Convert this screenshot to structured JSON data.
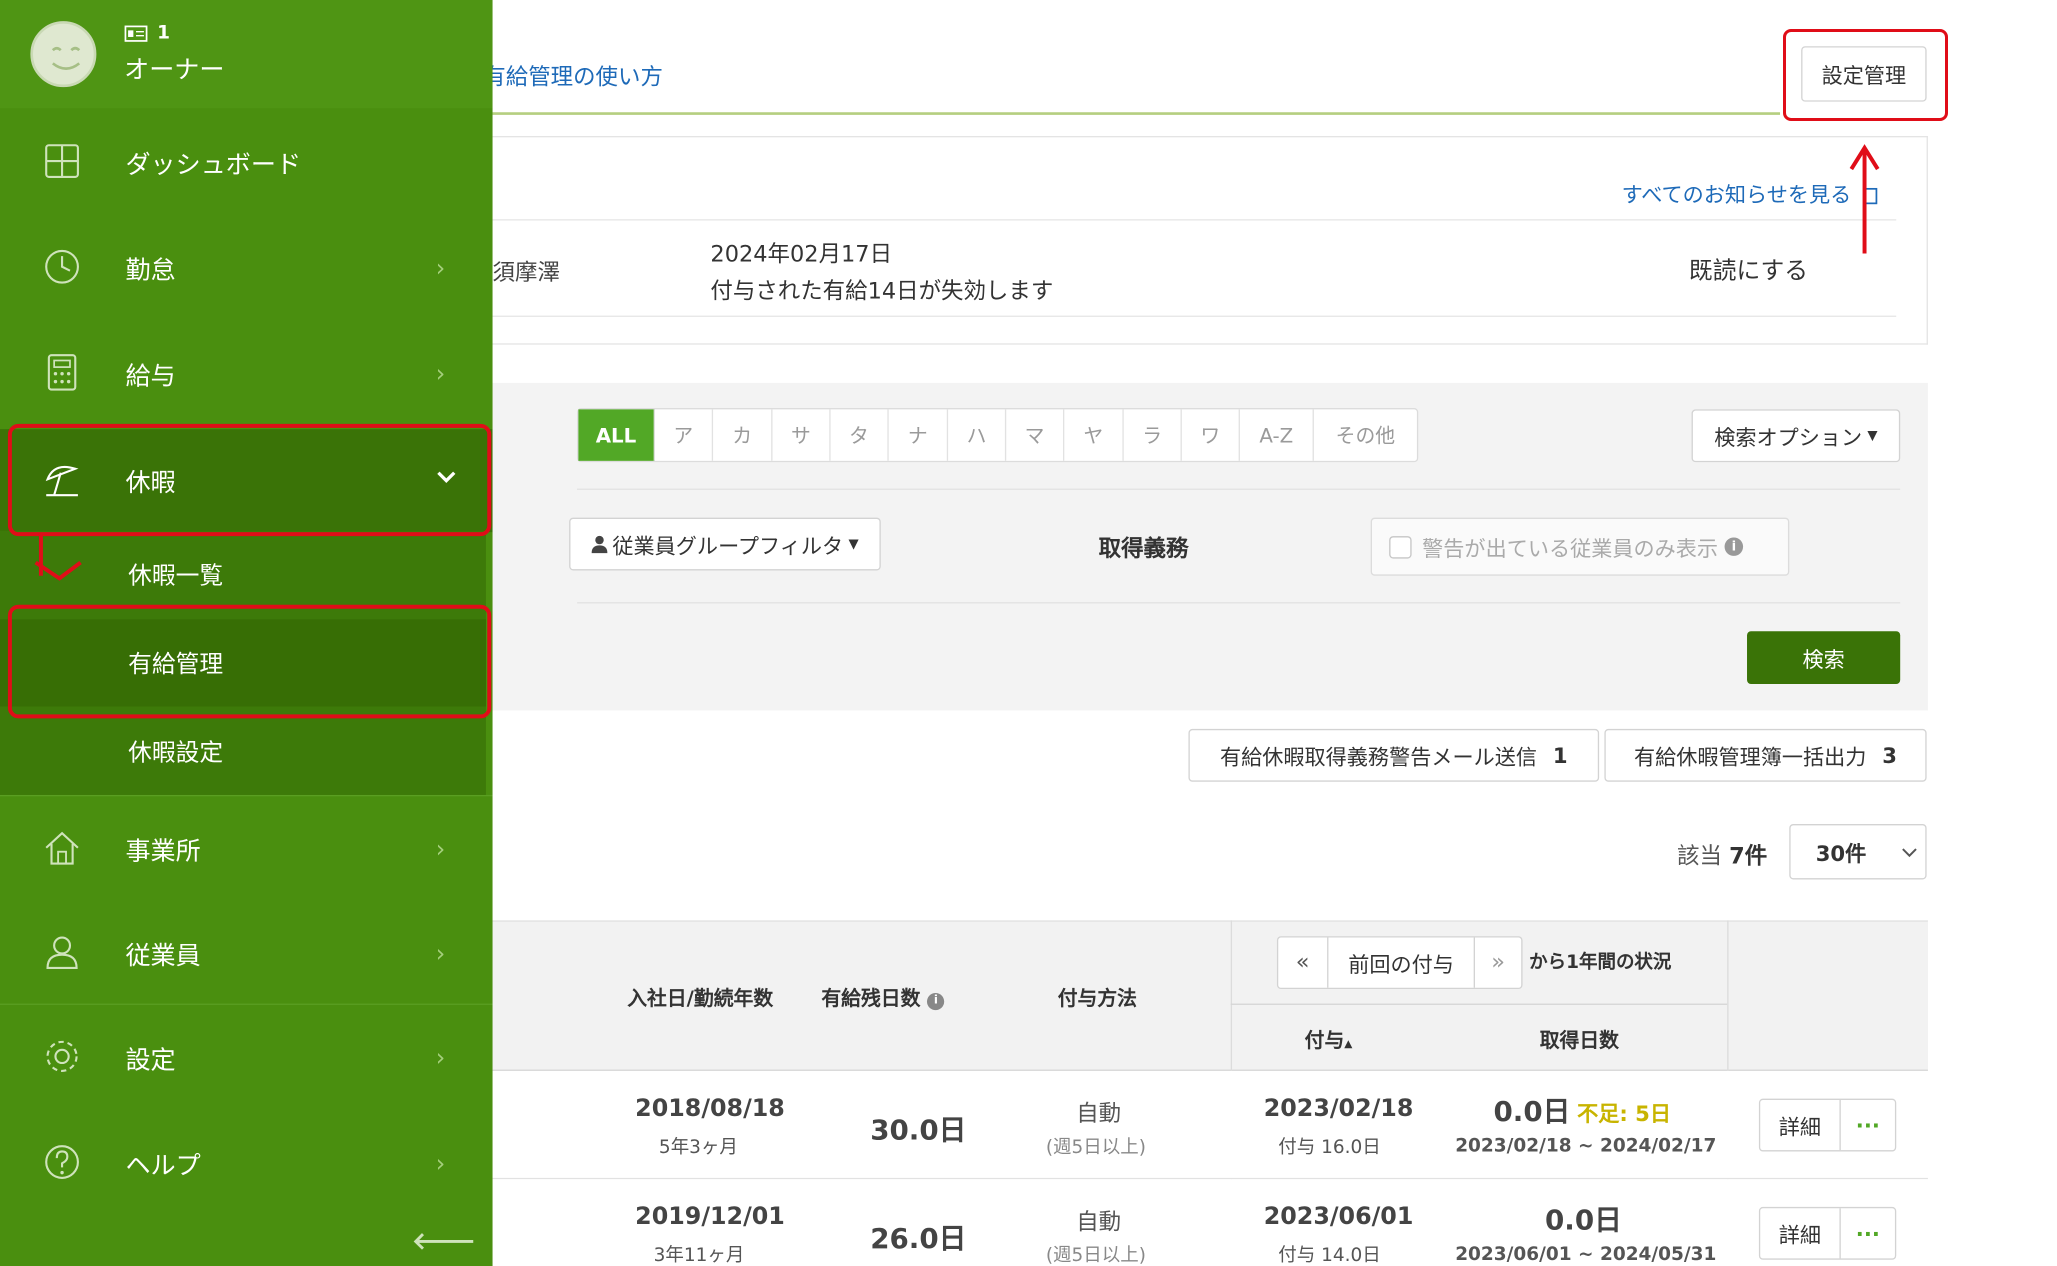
{
  "user": {
    "badge": "1",
    "role": "オーナー"
  },
  "sidebar": {
    "items": [
      {
        "label": "ダッシュボード",
        "icon": "dashboard-icon"
      },
      {
        "label": "勤怠",
        "icon": "clock-icon"
      },
      {
        "label": "給与",
        "icon": "calculator-icon"
      },
      {
        "label": "休暇",
        "icon": "beach-umbrella-icon"
      },
      {
        "label": "事業所",
        "icon": "home-icon"
      },
      {
        "label": "従業員",
        "icon": "person-icon"
      },
      {
        "label": "設定",
        "icon": "gear-icon"
      },
      {
        "label": "ヘルプ",
        "icon": "question-icon"
      }
    ],
    "submenu": [
      "休暇一覧",
      "有給管理",
      "休暇設定"
    ]
  },
  "header": {
    "help_link": "有給管理の使い方",
    "settings_button": "設定管理"
  },
  "notice": {
    "see_all": "すべてのお知らせを見る",
    "employee": "須摩澤",
    "date": "2024年02月17日",
    "message": "付与された有給14日が失効します",
    "mark_read": "既読にする"
  },
  "search": {
    "kana": [
      "ALL",
      "ア",
      "カ",
      "サ",
      "タ",
      "ナ",
      "ハ",
      "マ",
      "ヤ",
      "ラ",
      "ワ",
      "A-Z",
      "その他"
    ],
    "active_kana": "ALL",
    "options_button": "検索オプション",
    "group_filter": "従業員グループフィルタ",
    "obligation_label": "取得義務",
    "warning_only_label": "警告が出ている従業員のみ表示",
    "warning_only_checked": false,
    "search_button": "検索"
  },
  "actions": {
    "mail_button": "有給休暇取得義務警告メール送信",
    "mail_count": "1",
    "export_button": "有給休暇管理簿一括出力",
    "export_count": "3"
  },
  "results": {
    "count_label": "該当",
    "count": "7件",
    "per_page": "30件"
  },
  "table": {
    "headers": {
      "hire_date": "入社日/勤続年数",
      "remaining": "有給残日数",
      "method": "付与方法",
      "prev_grant": "前回の付与",
      "status_suffix": "から1年間の状況",
      "grant": "付与",
      "taken": "取得日数"
    },
    "rows": [
      {
        "hire_date": "2018/08/18",
        "tenure": "5年3ヶ月",
        "remaining": "30.0日",
        "method": "自動",
        "method_note": "(週5日以上)",
        "grant_date": "2023/02/18",
        "grant_days": "付与 16.0日",
        "taken": "0.0日",
        "shortage": "不足: 5日",
        "period": "2023/02/18 ~ 2024/02/17",
        "detail": "詳細",
        "more": "···"
      },
      {
        "hire_date": "2019/12/01",
        "tenure": "3年11ヶ月",
        "remaining": "26.0日",
        "method": "自動",
        "method_note": "(週5日以上)",
        "grant_date": "2023/06/01",
        "grant_days": "付与 14.0日",
        "taken": "0.0日",
        "shortage": "",
        "period": "2023/06/01 ~ 2024/05/31",
        "detail": "詳細",
        "more": "···"
      }
    ]
  },
  "colors": {
    "sidebar": "#4a8f0f",
    "sidebar_active": "#3a7307",
    "accent_green": "#52a826",
    "link_blue": "#1e6ab8",
    "annotation_red": "#e00d18",
    "shortage_yellow": "#c8b400"
  }
}
